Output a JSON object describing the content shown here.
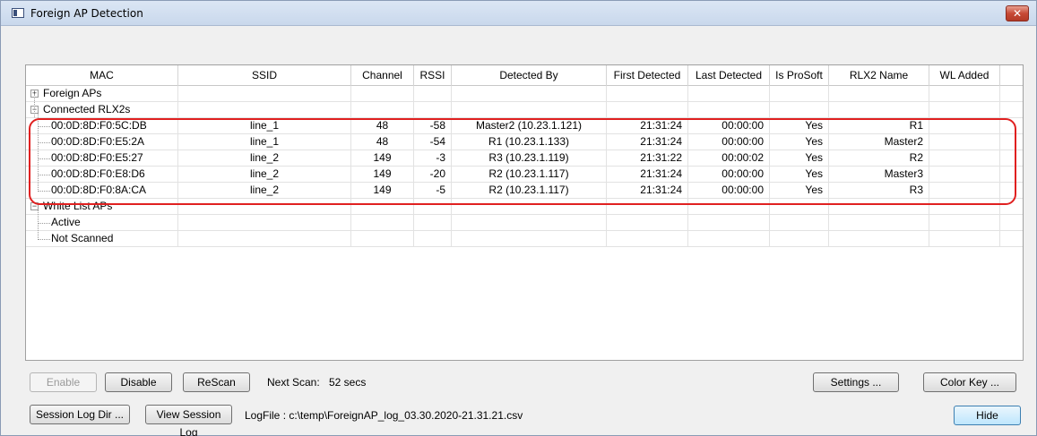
{
  "window": {
    "title": "Foreign AP Detection",
    "close_glyph": "✕"
  },
  "grid": {
    "columns": [
      "MAC",
      "SSID",
      "Channel",
      "RSSI",
      "Detected By",
      "First Detected",
      "Last Detected",
      "Is ProSoft",
      "RLX2 Name",
      "WL Added"
    ],
    "groups": {
      "foreign": "Foreign APs",
      "connected": "Connected RLX2s",
      "whitelist": "White List APs",
      "active": "Active",
      "not_scanned": "Not Scanned"
    },
    "rows": [
      {
        "mac": "00:0D:8D:F0:5C:DB",
        "ssid": "line_1",
        "channel": "48",
        "rssi": "-58",
        "detected_by": "Master2 (10.23.1.121)",
        "first": "21:31:24",
        "last": "00:00:00",
        "prosoft": "Yes",
        "name": "R1"
      },
      {
        "mac": "00:0D:8D:F0:E5:2A",
        "ssid": "line_1",
        "channel": "48",
        "rssi": "-54",
        "detected_by": "R1 (10.23.1.133)",
        "first": "21:31:24",
        "last": "00:00:00",
        "prosoft": "Yes",
        "name": "Master2"
      },
      {
        "mac": "00:0D:8D:F0:E5:27",
        "ssid": "line_2",
        "channel": "149",
        "rssi": "-3",
        "detected_by": "R3 (10.23.1.119)",
        "first": "21:31:22",
        "last": "00:00:02",
        "prosoft": "Yes",
        "name": "R2"
      },
      {
        "mac": "00:0D:8D:F0:E8:D6",
        "ssid": "line_2",
        "channel": "149",
        "rssi": "-20",
        "detected_by": "R2 (10.23.1.117)",
        "first": "21:31:24",
        "last": "00:00:00",
        "prosoft": "Yes",
        "name": "Master3"
      },
      {
        "mac": "00:0D:8D:F0:8A:CA",
        "ssid": "line_2",
        "channel": "149",
        "rssi": "-5",
        "detected_by": "R2 (10.23.1.117)",
        "first": "21:31:24",
        "last": "00:00:00",
        "prosoft": "Yes",
        "name": "R3"
      }
    ]
  },
  "controls": {
    "enable": "Enable",
    "disable": "Disable",
    "rescan": "ReScan",
    "next_scan_label": "Next Scan:",
    "next_scan_value": "52 secs",
    "settings": "Settings ...",
    "color_key": "Color Key ...",
    "session_log_dir": "Session Log Dir ...",
    "view_session_log": "View Session Log",
    "logfile_text": "LogFile : c:\\temp\\ForeignAP_log_03.30.2020-21.31.21.csv",
    "hide": "Hide"
  },
  "colors": {
    "highlight": "#e02020"
  }
}
